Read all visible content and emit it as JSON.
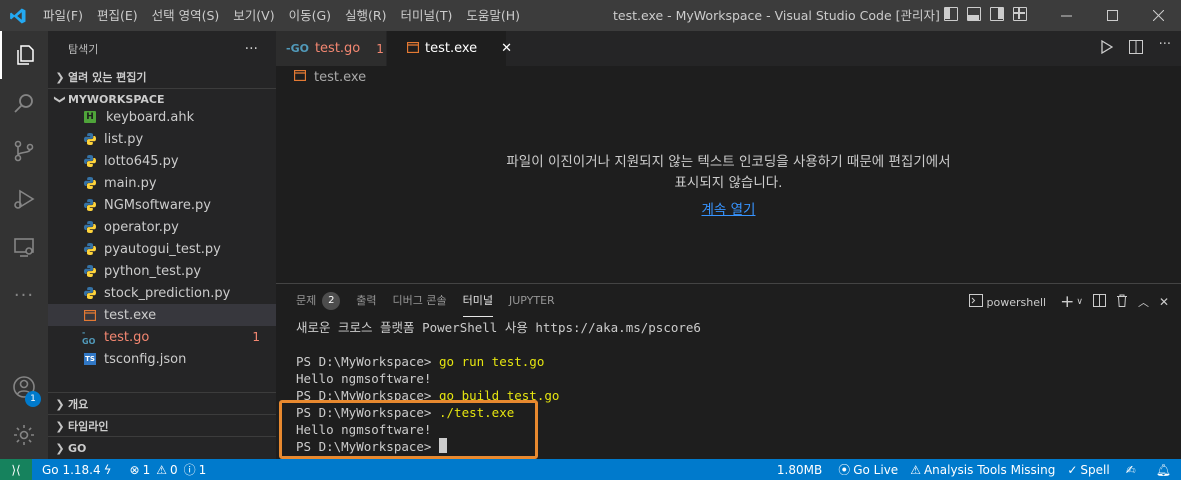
{
  "menu": [
    "파일(F)",
    "편집(E)",
    "선택 영역(S)",
    "보기(V)",
    "이동(G)",
    "실행(R)",
    "터미널(T)",
    "도움말(H)"
  ],
  "window_title": "test.exe - MyWorkspace - Visual Studio Code [관리자]",
  "sidebar": {
    "title": "탐색기",
    "more": "···",
    "open_editors": "열려 있는 편집기",
    "workspace": "MYWORKSPACE",
    "files": [
      {
        "name": "keyboard.ahk",
        "icon": "H"
      },
      {
        "name": "list.py"
      },
      {
        "name": "lotto645.py"
      },
      {
        "name": "main.py"
      },
      {
        "name": "NGMsoftware.py"
      },
      {
        "name": "operator.py"
      },
      {
        "name": "pyautogui_test.py"
      },
      {
        "name": "python_test.py"
      },
      {
        "name": "stock_prediction.py"
      },
      {
        "name": "test.exe"
      },
      {
        "name": "test.go",
        "errors": "1",
        "icon": "-GO"
      },
      {
        "name": "tsconfig.json",
        "icon": "TS"
      }
    ],
    "outline": "개요",
    "timeline": "타임라인",
    "go": "GO"
  },
  "activity_badge": "1",
  "tabs": [
    {
      "name": "test.go",
      "errors": "1",
      "icon": "-GO"
    },
    {
      "name": "test.exe",
      "close": "✕"
    }
  ],
  "breadcrumb": "test.exe",
  "editor_message": "파일이 이진이거나 지원되지 않는 텍스트 인코딩을 사용하기 때문에 편집기에서 표시되지 않습니다.",
  "editor_link": "계속 열기",
  "panel": {
    "tabs": [
      "문제",
      "출력",
      "디버그 콘솔",
      "터미널",
      "JUPYTER"
    ],
    "problems_count": "2",
    "shell": "powershell"
  },
  "terminal": {
    "banner": "새로운 크로스 플랫폼 PowerShell 사용 https://aka.ms/pscore6",
    "prompt": "PS D:\\MyWorkspace> ",
    "cmd1": "go run test.go",
    "out1": "Hello ngmsoftware!",
    "cmd2": "go build test.go",
    "cmd3": "./test.exe",
    "out3": "Hello ngmsoftware!"
  },
  "status": {
    "go_version": "Go 1.18.4",
    "errors": "1",
    "warnings": "0",
    "info": "1",
    "memory": "1.80MB",
    "golive": "Go Live",
    "analysis": "Analysis Tools Missing",
    "spell": "Spell"
  },
  "colors": {
    "accent": "#007acc",
    "highlight_box": "#e8892f",
    "remote": "#16825d"
  }
}
